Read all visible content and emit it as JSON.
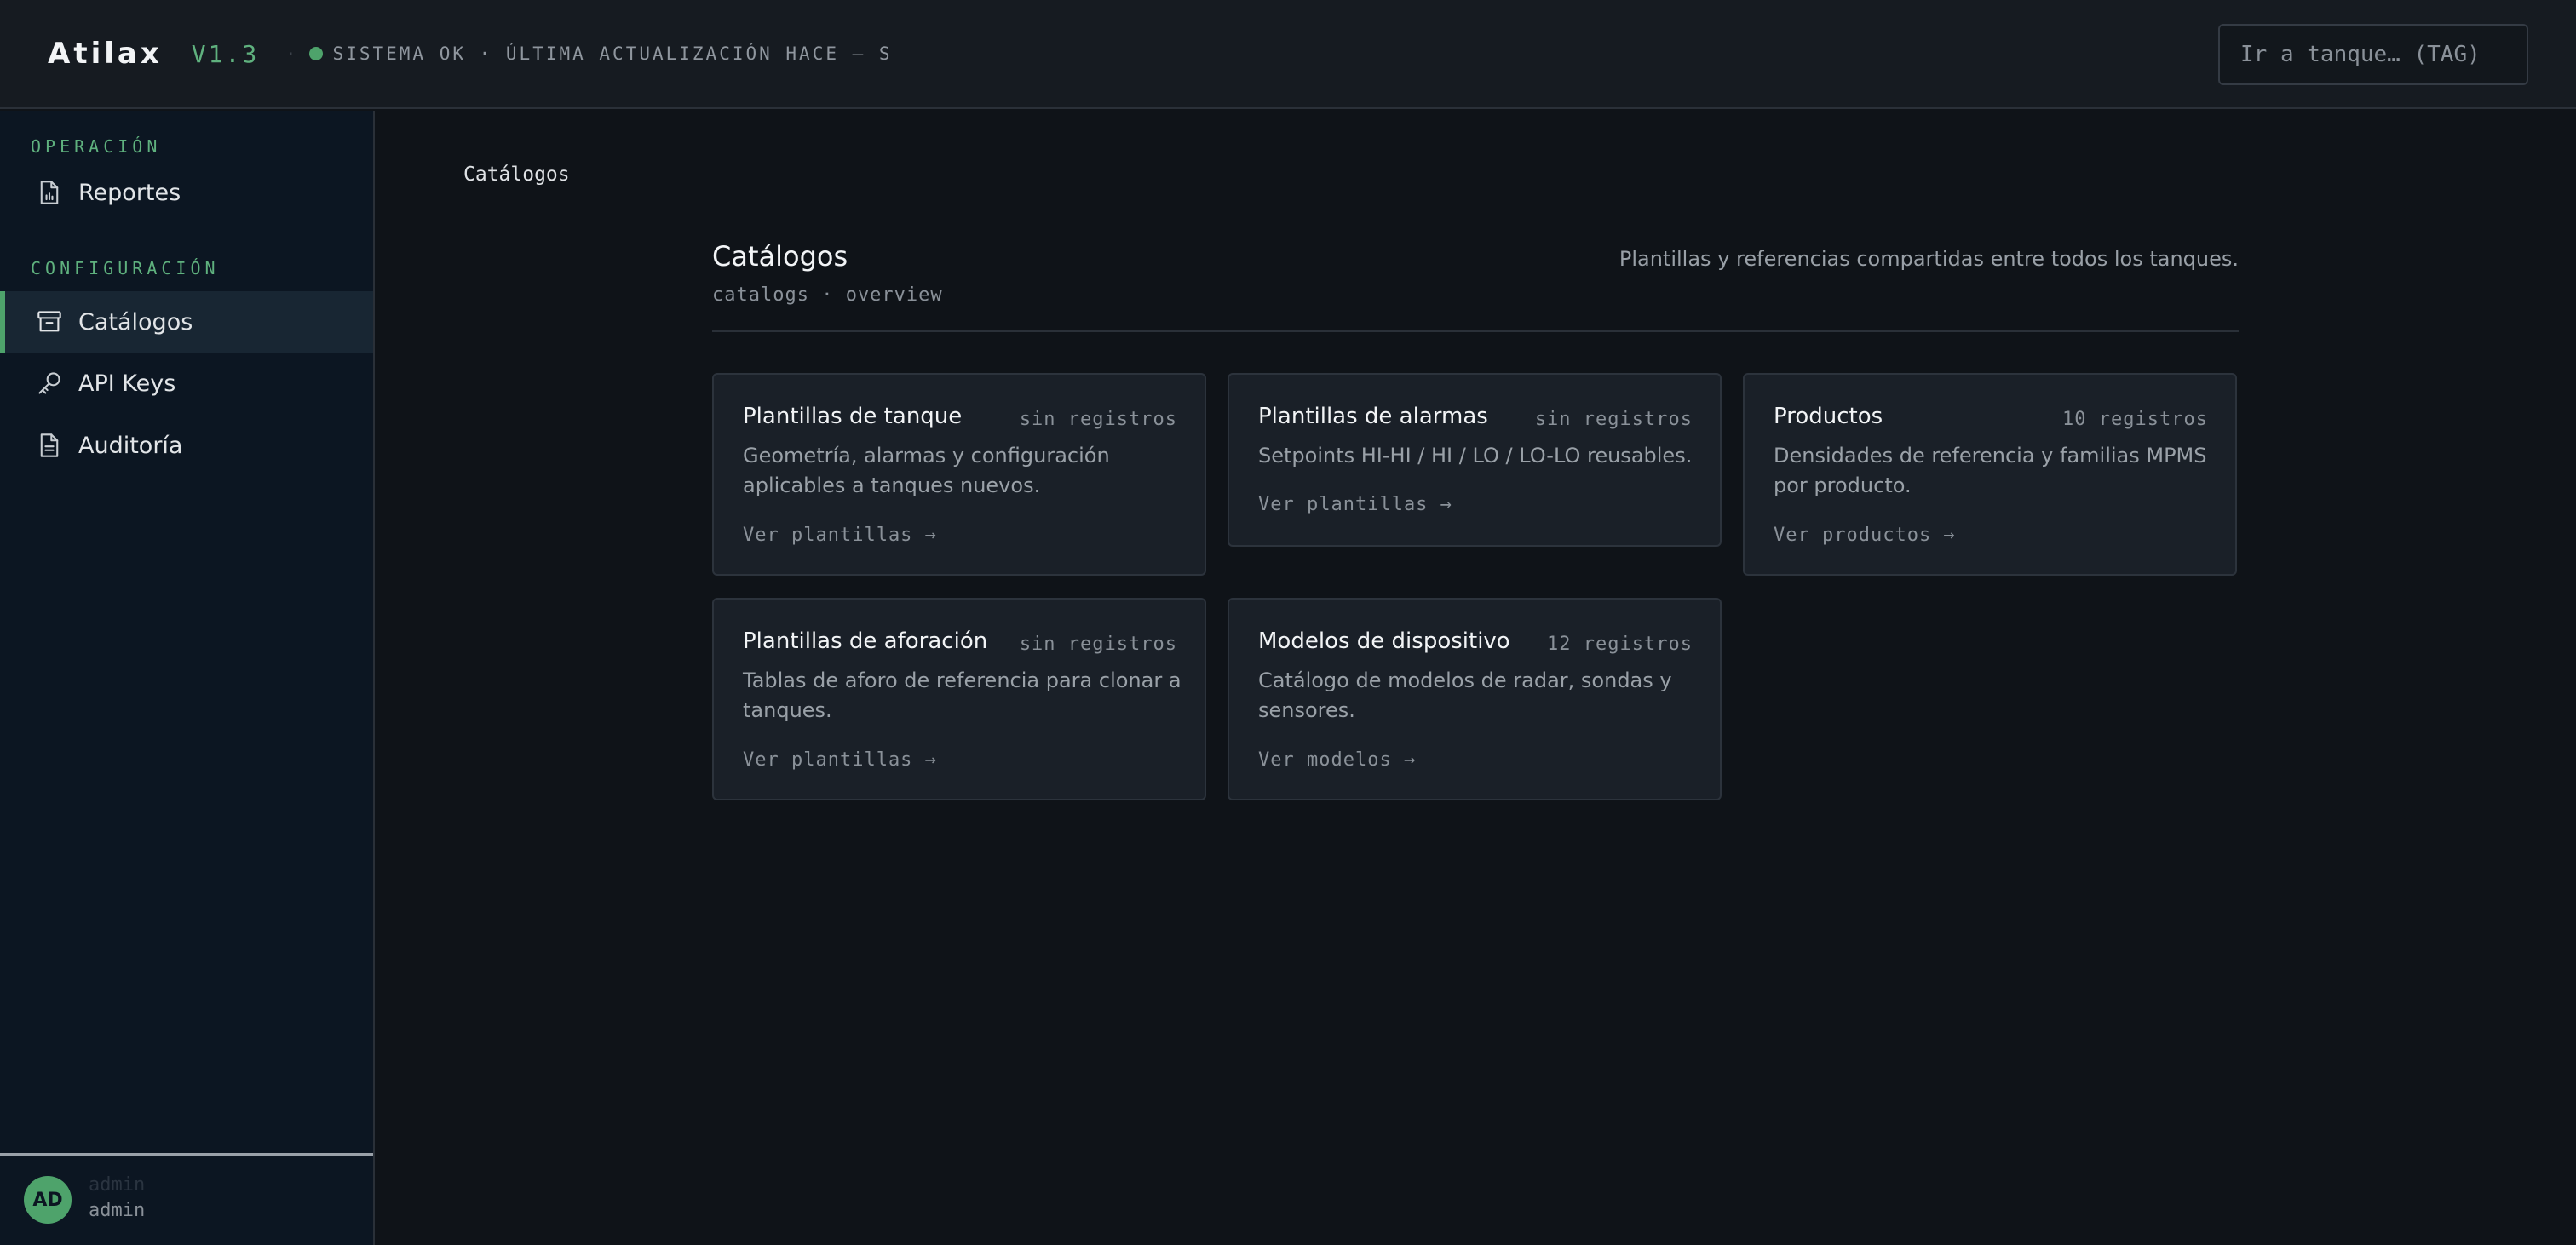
{
  "header": {
    "brand": "Atilax",
    "version": "V1.3",
    "separator": "·",
    "status_text": "SISTEMA OK · ÚLTIMA ACTUALIZACIÓN HACE — S",
    "status_color": "#4ea36b",
    "search_placeholder": "Ir a tanque… (TAG)"
  },
  "sidebar": {
    "sections": [
      {
        "label": "OPERACIÓN",
        "items": [
          {
            "label": "Reportes",
            "icon": "report-file-icon",
            "active": false
          }
        ]
      },
      {
        "label": "CONFIGURACIÓN",
        "items": [
          {
            "label": "Catálogos",
            "icon": "archive-box-icon",
            "active": true
          },
          {
            "label": "API Keys",
            "icon": "key-icon",
            "active": false
          },
          {
            "label": "Auditoría",
            "icon": "document-icon",
            "active": false
          }
        ]
      }
    ],
    "user": {
      "initials": "AD",
      "name": "admin",
      "role": "admin"
    }
  },
  "breadcrumb": "Catálogos",
  "page": {
    "title": "Catálogos",
    "subtitle": "catalogs · overview",
    "description": "Plantillas y referencias compartidas entre todos los tanques."
  },
  "cards": [
    {
      "title": "Plantillas de tanque",
      "count": "sin registros",
      "description": "Geometría, alarmas y configuración aplicables a tanques nuevos.",
      "link": "Ver plantillas →"
    },
    {
      "title": "Plantillas de alarmas",
      "count": "sin registros",
      "description": "Setpoints HI-HI / HI / LO / LO-LO reusables.",
      "link": "Ver plantillas →"
    },
    {
      "title": "Productos",
      "count": "10 registros",
      "description": "Densidades de referencia y familias MPMS por producto.",
      "link": "Ver productos →"
    },
    {
      "title": "Plantillas de aforación",
      "count": "sin registros",
      "description": "Tablas de aforo de referencia para clonar a tanques.",
      "link": "Ver plantillas →"
    },
    {
      "title": "Modelos de dispositivo",
      "count": "12 registros",
      "description": "Catálogo de modelos de radar, sondas y sensores.",
      "link": "Ver modelos →"
    }
  ],
  "colors": {
    "accent": "#4ea36b",
    "background": "#0f1318",
    "sidebar": "#0c1622",
    "card": "#1a2028"
  }
}
